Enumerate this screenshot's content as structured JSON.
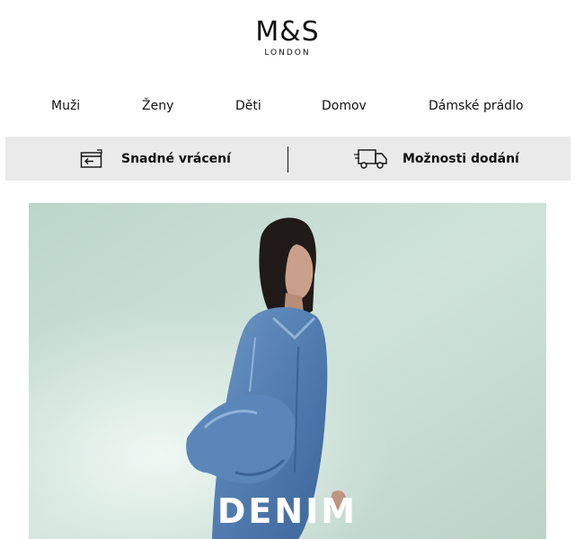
{
  "brand": {
    "logo_main": "M&S",
    "logo_sub": "LONDON"
  },
  "nav": {
    "items": [
      {
        "label": "Muži"
      },
      {
        "label": "Ženy"
      },
      {
        "label": "Děti"
      },
      {
        "label": "Domov"
      },
      {
        "label": "Dámské prádlo"
      }
    ]
  },
  "info_bar": {
    "returns_label": "Snadné vrácení",
    "returns_icon": "return-package-icon",
    "delivery_label": "Možnosti dodání",
    "delivery_icon": "delivery-truck-icon"
  },
  "hero": {
    "headline": "DENIM",
    "background_color": "#c9dfd6"
  }
}
